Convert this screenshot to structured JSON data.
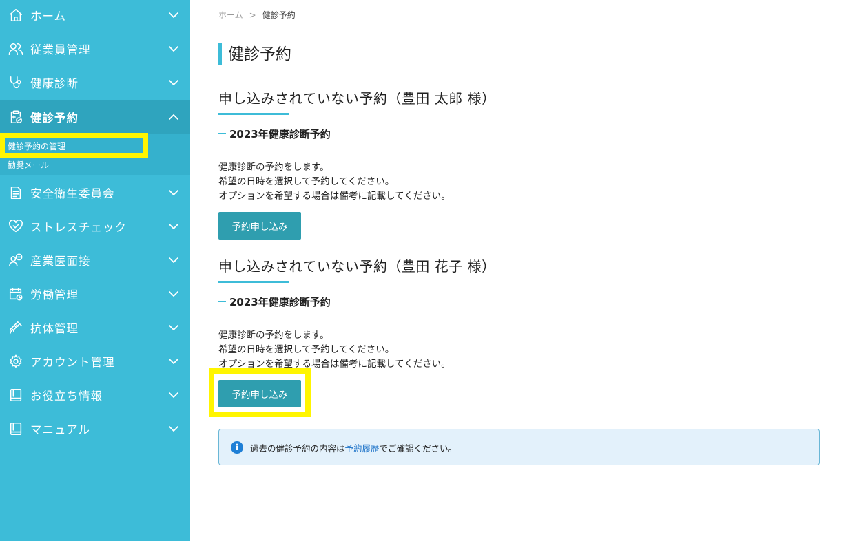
{
  "sidebar": {
    "items": [
      {
        "label": "ホーム"
      },
      {
        "label": "従業員管理"
      },
      {
        "label": "健康診断"
      },
      {
        "label": "健診予約"
      },
      {
        "label": "安全衛生委員会"
      },
      {
        "label": "ストレスチェック"
      },
      {
        "label": "産業医面接"
      },
      {
        "label": "労働管理"
      },
      {
        "label": "抗体管理"
      },
      {
        "label": "アカウント管理"
      },
      {
        "label": "お役立ち情報"
      },
      {
        "label": "マニュアル"
      }
    ],
    "submenu": {
      "active": "健診予約の管理",
      "other": "勧奨メール"
    }
  },
  "breadcrumb": {
    "home": "ホーム",
    "separator": ">",
    "current": "健診予約"
  },
  "page_title": "健診予約",
  "sections": [
    {
      "heading": "申し込みされていない予約（豊田 太郎 様）",
      "sub_heading": "2023年健康診断予約",
      "lines": [
        "健康診断の予約をします。",
        "希望の日時を選択して予約してください。",
        "オプションを希望する場合は備考に記載してください。"
      ],
      "button": "予約申し込み"
    },
    {
      "heading": "申し込みされていない予約（豊田 花子 様）",
      "sub_heading": "2023年健康診断予約",
      "lines": [
        "健康診断の予約をします。",
        "希望の日時を選択して予約してください。",
        "オプションを希望する場合は備考に記載してください。"
      ],
      "button": "予約申し込み"
    }
  ],
  "info": {
    "icon": "i",
    "text_before": "過去の健診予約の内容は",
    "link": "予約履歴",
    "text_after": "でご確認ください。"
  },
  "colors": {
    "sidebar": "#3dbcd8",
    "sidebar_active": "#2fa4be",
    "button": "#2f9eaf",
    "highlight": "#fff500",
    "link": "#1e73c8"
  },
  "icons": [
    "home-icon",
    "users-icon",
    "stethoscope-icon",
    "clipboard-check-icon",
    "document-icon",
    "heart-icon",
    "person-minus-icon",
    "calendar-clock-icon",
    "syringe-icon",
    "gear-icon",
    "book-icon",
    "manual-icon",
    "chevron-down-icon",
    "chevron-up-icon",
    "info-icon"
  ]
}
